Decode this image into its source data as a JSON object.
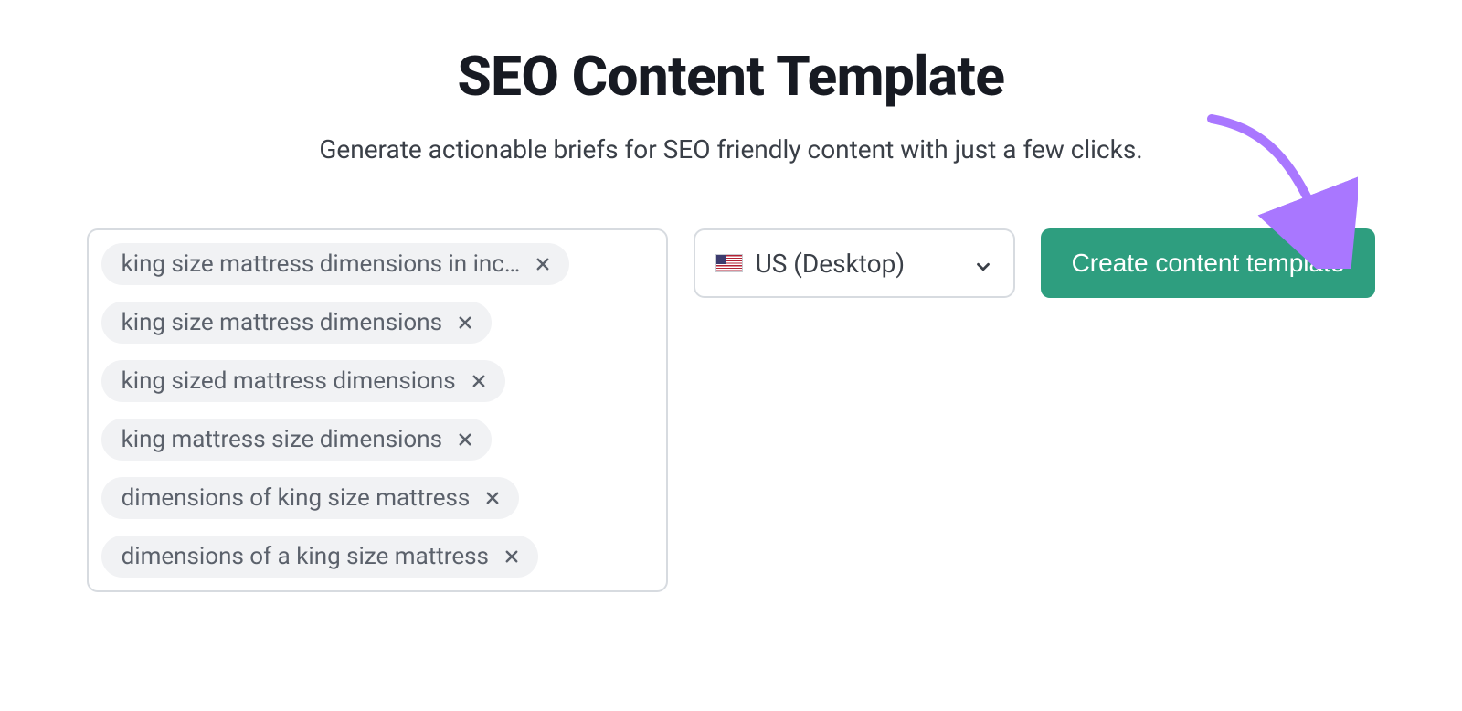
{
  "header": {
    "title": "SEO Content Template",
    "subtitle": "Generate actionable briefs for SEO friendly content with just a few clicks."
  },
  "keywords": [
    "king size mattress dimensions in inc…",
    "king size mattress dimensions",
    "king sized mattress dimensions",
    "king mattress size dimensions",
    "dimensions of king size mattress",
    "dimensions of a king size mattress"
  ],
  "region": {
    "label": "US (Desktop)"
  },
  "actions": {
    "create_label": "Create content template"
  }
}
